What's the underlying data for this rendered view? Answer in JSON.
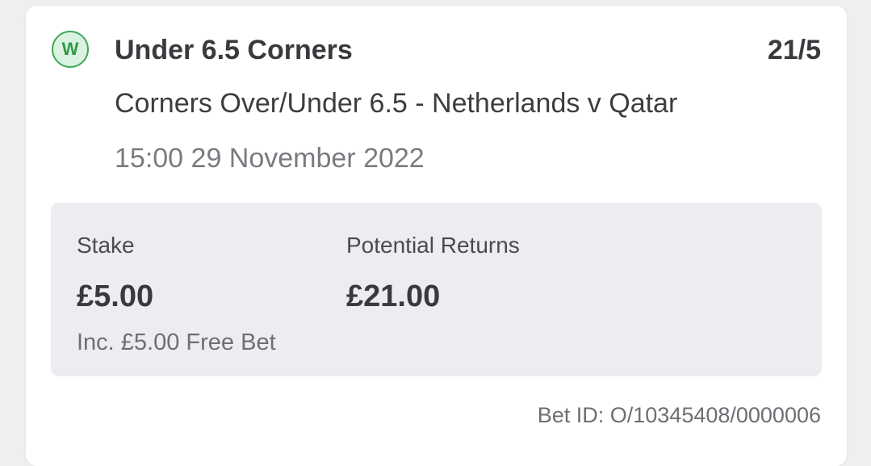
{
  "bet": {
    "status_letter": "W",
    "status_color": "#42a95a",
    "selection": "Under 6.5 Corners",
    "odds": "21/5",
    "market": "Corners Over/Under 6.5 - Netherlands v Qatar",
    "datetime": "15:00 29 November 2022"
  },
  "summary": {
    "stake_label": "Stake",
    "stake_value": "£5.00",
    "free_bet_note": "Inc. £5.00 Free Bet",
    "returns_label": "Potential Returns",
    "returns_value": "£21.00"
  },
  "footer": {
    "bet_id": "Bet ID: O/10345408/0000006"
  }
}
